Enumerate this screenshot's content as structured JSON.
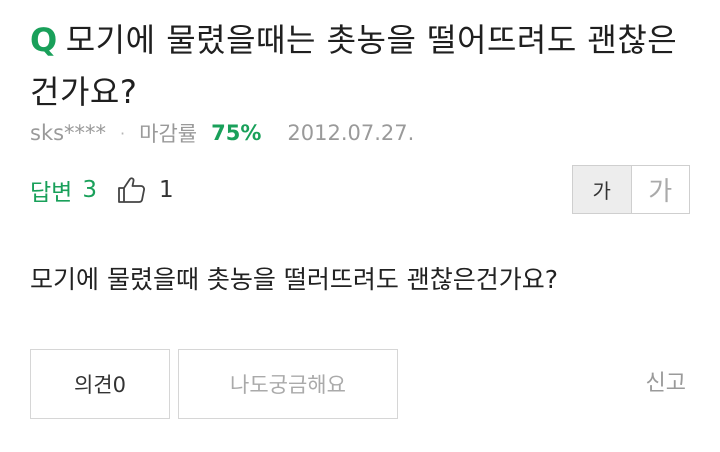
{
  "question": {
    "mark": "Q",
    "title": "모기에 물렸을때는 촛농을 떨어뜨려도 괜찮은 건가요?"
  },
  "meta": {
    "author": "sks****",
    "separator": "·",
    "close_rate_label": "마감률",
    "close_rate": "75%",
    "date": "2012.07.27."
  },
  "stats": {
    "answers_label": "답변",
    "answers_count": "3",
    "like_count": "1"
  },
  "font_size": {
    "small_label": "가",
    "large_label": "가"
  },
  "body": {
    "text": "모기에 물렸을때 촛농을 떨러뜨려도 괜찮은건가요?"
  },
  "actions": {
    "opinion_label": "의견0",
    "curious_label": "나도궁금해요",
    "report_label": "신고"
  },
  "colors": {
    "accent": "#19a05a",
    "muted": "#9a9a9a"
  }
}
